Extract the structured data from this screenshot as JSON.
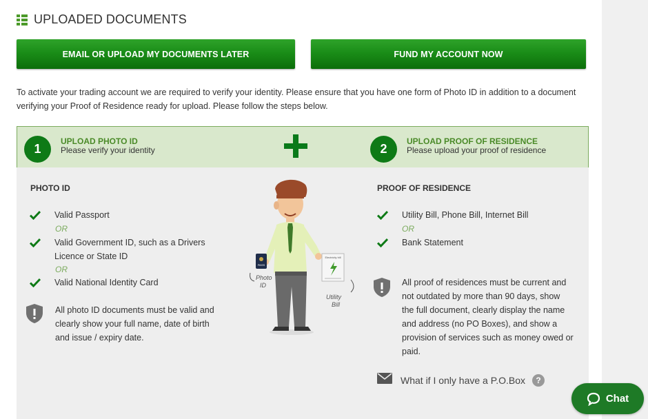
{
  "header": {
    "title": "UPLOADED DOCUMENTS",
    "icon": "list-icon"
  },
  "buttons": {
    "email_later": "EMAIL OR UPLOAD MY DOCUMENTS LATER",
    "fund_now": "FUND MY ACCOUNT NOW"
  },
  "intro": {
    "line1": "To activate your trading account we are required to verify your identity. Please ensure that you have one form of Photo ID in addition to a document",
    "line2": "verifying your Proof of Residence ready for upload. Please follow the steps below."
  },
  "steps": [
    {
      "number": "1",
      "title": "UPLOAD PHOTO ID",
      "subtitle": "Please verify your identity"
    },
    {
      "number": "2",
      "title": "UPLOAD PROOF OF RESIDENCE",
      "subtitle": "Please upload your proof of residence"
    }
  ],
  "photo_id": {
    "title": "PHOTO ID",
    "items": [
      "Valid Passport",
      "Valid Government ID, such as a Drivers",
      "Licence or State ID",
      "Valid National Identity Card"
    ],
    "or_label": "OR",
    "note": [
      "All photo ID documents must be valid and",
      "clearly show your full name, date of birth",
      "and issue / expiry date."
    ]
  },
  "proof_of_residence": {
    "title": "PROOF OF RESIDENCE",
    "items": [
      "Utility Bill, Phone Bill, Internet Bill",
      "Bank Statement"
    ],
    "or_label": "OR",
    "note": [
      "All proof of residences must be current and",
      "not outdated by more than 90 days, show",
      "the full document, clearly display the name",
      "and address (no PO Boxes), and show a",
      "provision of services such as money owed or",
      "paid."
    ]
  },
  "illustration": {
    "left_label_1": "Photo",
    "left_label_2": "ID",
    "right_label_1": "Utility",
    "right_label_2": "Bill",
    "paper_heading": "Electricity bill"
  },
  "pobox": {
    "text": "What if I only have a P.O.Box",
    "help": "?"
  },
  "chat": {
    "label": "Chat"
  },
  "colors": {
    "brand_green": "#0e7a16",
    "accent_green": "#4a8a28",
    "step_bg": "#d9e8cc"
  }
}
